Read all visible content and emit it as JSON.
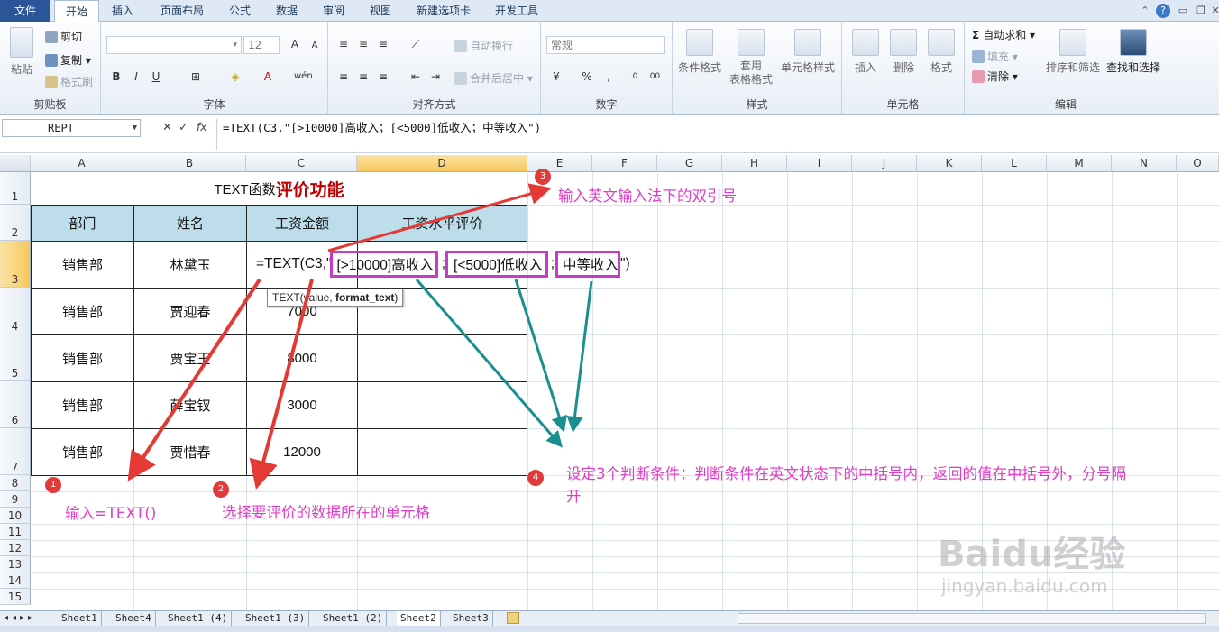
{
  "ribbon_tabs": [
    "文件",
    "开始",
    "插入",
    "页面布局",
    "公式",
    "数据",
    "审阅",
    "视图",
    "新建选项卡",
    "开发工具"
  ],
  "clipboard": {
    "paste": "粘贴",
    "cut": "剪切",
    "copy": "复制",
    "format_painter": "格式刷",
    "label": "剪贴板"
  },
  "font": {
    "size": "12",
    "label": "字体"
  },
  "alignment": {
    "wrap": "自动换行",
    "merge": "合并后居中",
    "label": "对齐方式"
  },
  "number": {
    "format": "常规",
    "label": "数字"
  },
  "styles": {
    "conditional": "条件格式",
    "table": "套用\n表格格式",
    "cell_styles": "单元格样式",
    "label": "样式"
  },
  "cells": {
    "insert": "插入",
    "delete": "删除",
    "format": "格式",
    "label": "单元格"
  },
  "editing": {
    "autosum": "自动求和",
    "fill": "填充",
    "clear": "清除",
    "sort": "排序和筛选",
    "find": "查找和选择",
    "label": "编辑"
  },
  "formula_bar": {
    "name_box": "REPT",
    "formula": "=TEXT(C3,\"[>10000]高收入；[<5000]低收入；中等收入\")"
  },
  "columns": [
    "A",
    "B",
    "C",
    "D",
    "E",
    "F",
    "G",
    "H",
    "I",
    "J",
    "K",
    "L",
    "M",
    "N",
    "O"
  ],
  "rows": [
    "1",
    "2",
    "3",
    "4",
    "5",
    "6",
    "7",
    "8",
    "9",
    "10",
    "11",
    "12",
    "13",
    "14",
    "15"
  ],
  "sheet": {
    "title_part1": "TEXT函数",
    "title_part2": "评价功能",
    "headers": [
      "部门",
      "姓名",
      "工资金额",
      "工资水平评价"
    ],
    "rows": [
      [
        "销售部",
        "林黛玉",
        "",
        ""
      ],
      [
        "销售部",
        "贾迎春",
        "7000",
        ""
      ],
      [
        "销售部",
        "贾宝玉",
        "8000",
        ""
      ],
      [
        "销售部",
        "薛宝钗",
        "3000",
        ""
      ],
      [
        "销售部",
        "贾惜春",
        "12000",
        ""
      ]
    ],
    "editing_prefix": "=TEXT(C3,\"",
    "editing_seg1": "[>10000]高收入",
    "editing_seg2": "[<5000]低收入",
    "editing_seg3": "中等收入",
    "sep": ";",
    "editing_suffix": "\")",
    "tooltip_fn": "TEXT(value, ",
    "tooltip_arg": "format_text",
    "tooltip_end": ")"
  },
  "annotations": {
    "m1": "1",
    "m2": "2",
    "m3": "3",
    "m4": "4",
    "a1": "输入=TEXT()",
    "a2": "选择要评价的数据所在的单元格",
    "a3": "输入英文输入法下的双引号",
    "a4_line1": "设定3个判断条件：判断条件在英文状态下的中括号内，返回的值在中括号外，分号隔",
    "a4_line2": "开"
  },
  "sheet_tabs": [
    "Sheet1",
    "Sheet4",
    "Sheet1 (4)",
    "Sheet1 (3)",
    "Sheet1 (2)",
    "Sheet2",
    "Sheet3"
  ],
  "active_sheet": "Sheet2",
  "watermark": {
    "main": "Baidu经验",
    "sub": "jingyan.baidu.com"
  },
  "colors": {
    "accent_pink": "#e03cc6",
    "arrow_red": "#e53935",
    "arrow_teal": "#1a8f8f",
    "header_fill": "#bcdde9",
    "title_red": "#c00000"
  }
}
